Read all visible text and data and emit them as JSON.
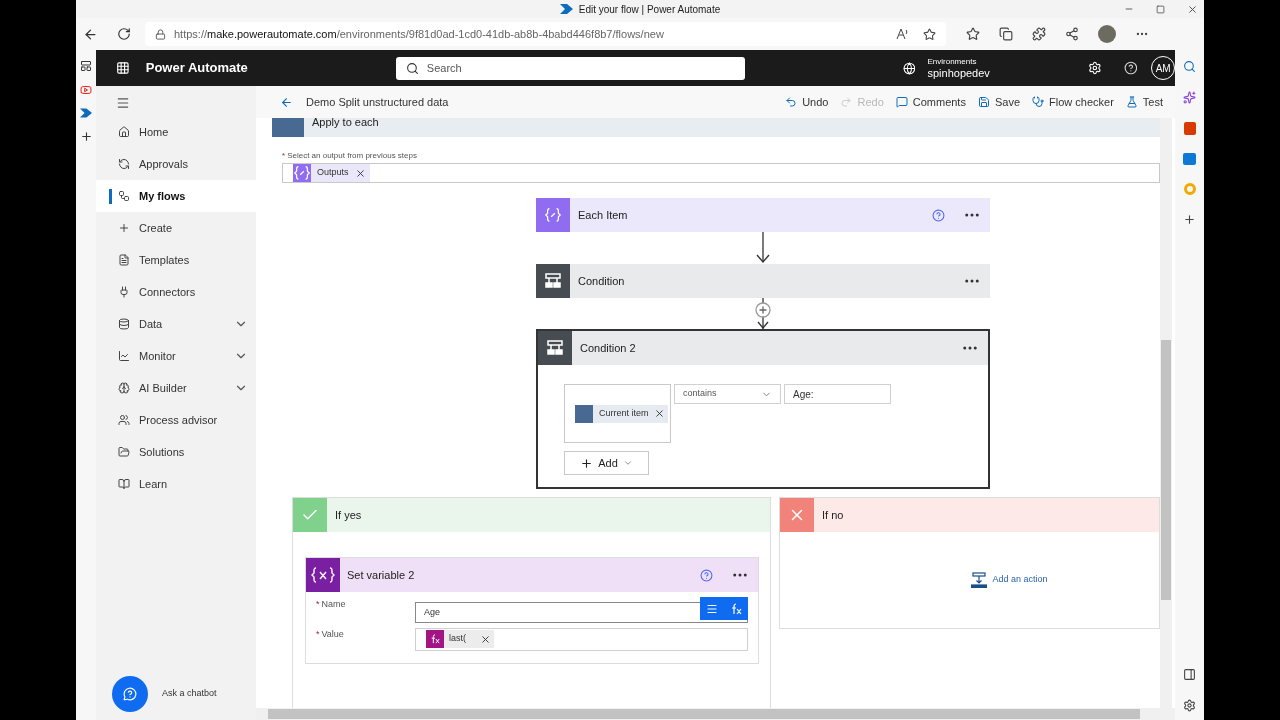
{
  "browser": {
    "title": "Edit your flow | Power Automate",
    "url": {
      "scheme": "https://",
      "host": "make.powerautomate.com",
      "path": "/environments/9f81d0ad-1cd0-41db-ab8b-4babd446f8b7/flows/new"
    }
  },
  "header": {
    "app_name": "Power Automate",
    "search": {
      "placeholder": "Search"
    },
    "environment": {
      "label": "Environments",
      "name": "spinhopedev"
    },
    "avatar": "AM"
  },
  "nav": {
    "items": [
      {
        "label": "Home",
        "kind": "home",
        "selected": false,
        "expandable": false
      },
      {
        "label": "Approvals",
        "kind": "approvals",
        "selected": false,
        "expandable": false
      },
      {
        "label": "My flows",
        "kind": "flows",
        "selected": true,
        "expandable": false
      },
      {
        "label": "Create",
        "kind": "create",
        "selected": false,
        "expandable": false
      },
      {
        "label": "Templates",
        "kind": "templates",
        "selected": false,
        "expandable": false
      },
      {
        "label": "Connectors",
        "kind": "connectors",
        "selected": false,
        "expandable": false
      },
      {
        "label": "Data",
        "kind": "data",
        "selected": false,
        "expandable": true
      },
      {
        "label": "Monitor",
        "kind": "monitor",
        "selected": false,
        "expandable": true
      },
      {
        "label": "AI Builder",
        "kind": "ai",
        "selected": false,
        "expandable": true
      },
      {
        "label": "Process advisor",
        "kind": "process",
        "selected": false,
        "expandable": false
      },
      {
        "label": "Solutions",
        "kind": "solutions",
        "selected": false,
        "expandable": false
      },
      {
        "label": "Learn",
        "kind": "learn",
        "selected": false,
        "expandable": false
      }
    ],
    "chatbot": "Ask a chatbot"
  },
  "toolbar": {
    "flow_name": "Demo Split unstructured data",
    "actions": [
      {
        "label": "Undo",
        "kind": "undo",
        "disabled": false
      },
      {
        "label": "Redo",
        "kind": "redo",
        "disabled": true
      },
      {
        "label": "Comments",
        "kind": "comments",
        "disabled": false
      },
      {
        "label": "Save",
        "kind": "save",
        "disabled": false
      },
      {
        "label": "Flow checker",
        "kind": "checker",
        "disabled": false
      },
      {
        "label": "Test",
        "kind": "test",
        "disabled": false
      }
    ]
  },
  "canvas": {
    "apply_to_each": {
      "title": "Apply to each",
      "field": {
        "label": "Select an output from previous steps",
        "required_mark": "*",
        "token": "Outputs"
      }
    },
    "steps": [
      {
        "title": "Each Item",
        "kind": "compose",
        "help": true,
        "selected": false
      },
      {
        "title": "Condition",
        "kind": "condition",
        "help": false,
        "selected": false
      },
      {
        "title": "Condition 2",
        "kind": "condition",
        "help": false,
        "selected": true
      }
    ],
    "condition": {
      "left_token": "Current item",
      "operator": "contains",
      "value": "Age:",
      "add_button": "Add"
    },
    "branches": [
      {
        "title": "If yes",
        "kind": "yes",
        "action": {
          "title": "Set variable 2",
          "fields": [
            {
              "label": "Name",
              "required_mark": "*",
              "kind": "text",
              "value": "Age",
              "focused": true
            },
            {
              "label": "Value",
              "required_mark": "*",
              "kind": "token",
              "value": "last("
            }
          ]
        }
      },
      {
        "title": "If no",
        "kind": "no",
        "add_action": "Add an action"
      }
    ]
  }
}
